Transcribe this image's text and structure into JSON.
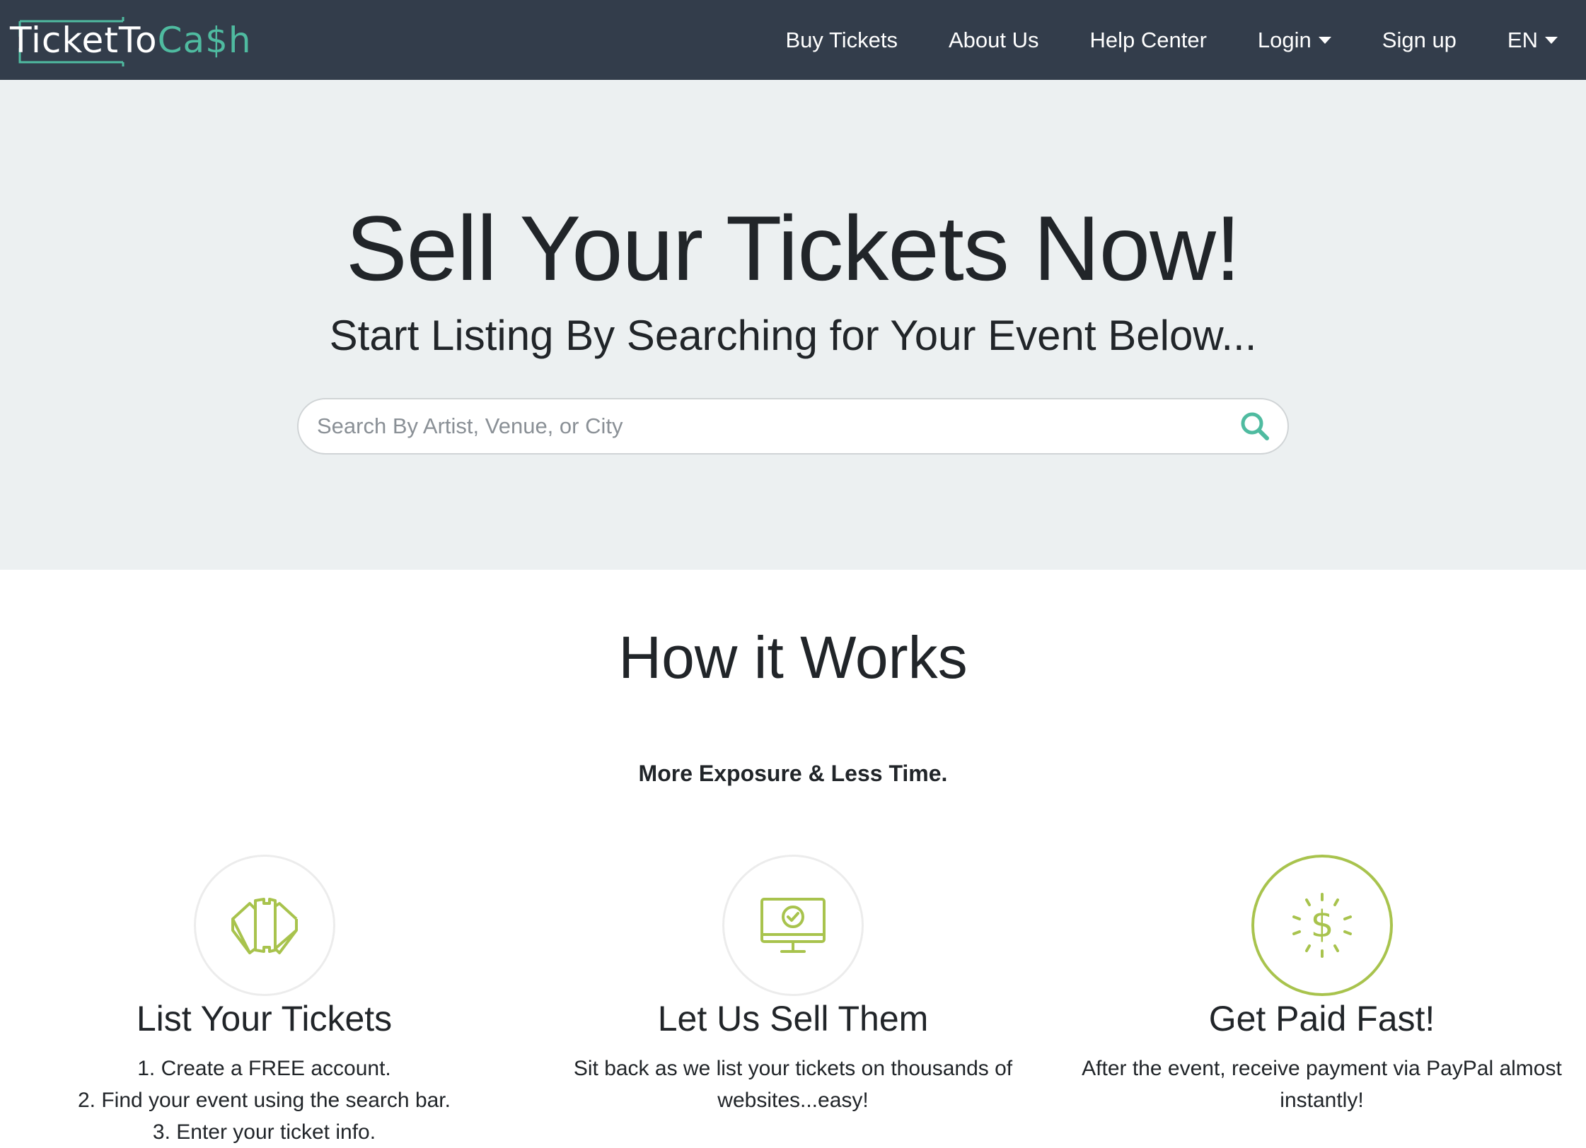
{
  "brand": {
    "name_part1": "TicketTo",
    "name_part2": "Ca$h",
    "accent_color": "#4fbba0",
    "navbar_color": "#333d4b"
  },
  "nav": {
    "buy_tickets": "Buy Tickets",
    "about_us": "About Us",
    "help_center": "Help Center",
    "login": "Login",
    "sign_up": "Sign up",
    "language": "EN"
  },
  "hero": {
    "title": "Sell Your Tickets Now!",
    "subtitle": "Start Listing By Searching for Your Event Below...",
    "search_placeholder": "Search By Artist, Venue, or City",
    "search_icon": "search-icon"
  },
  "how_it_works": {
    "title": "How it Works",
    "subtitle": "More Exposure & Less Time.",
    "icon_color": "#a8c34d",
    "steps": [
      {
        "icon": "tickets-icon",
        "title": "List Your Tickets",
        "lines": [
          "1. Create a FREE account.",
          "2. Find your event using the search bar.",
          "3. Enter your ticket info."
        ]
      },
      {
        "icon": "monitor-check-icon",
        "title": "Let Us Sell Them",
        "lines": [
          "Sit back as we list your tickets on thousands of",
          "websites...easy!"
        ]
      },
      {
        "icon": "dollar-shine-icon",
        "title": "Get Paid Fast!",
        "lines": [
          "After the event, receive payment via PayPal almost",
          "instantly!"
        ]
      }
    ]
  }
}
